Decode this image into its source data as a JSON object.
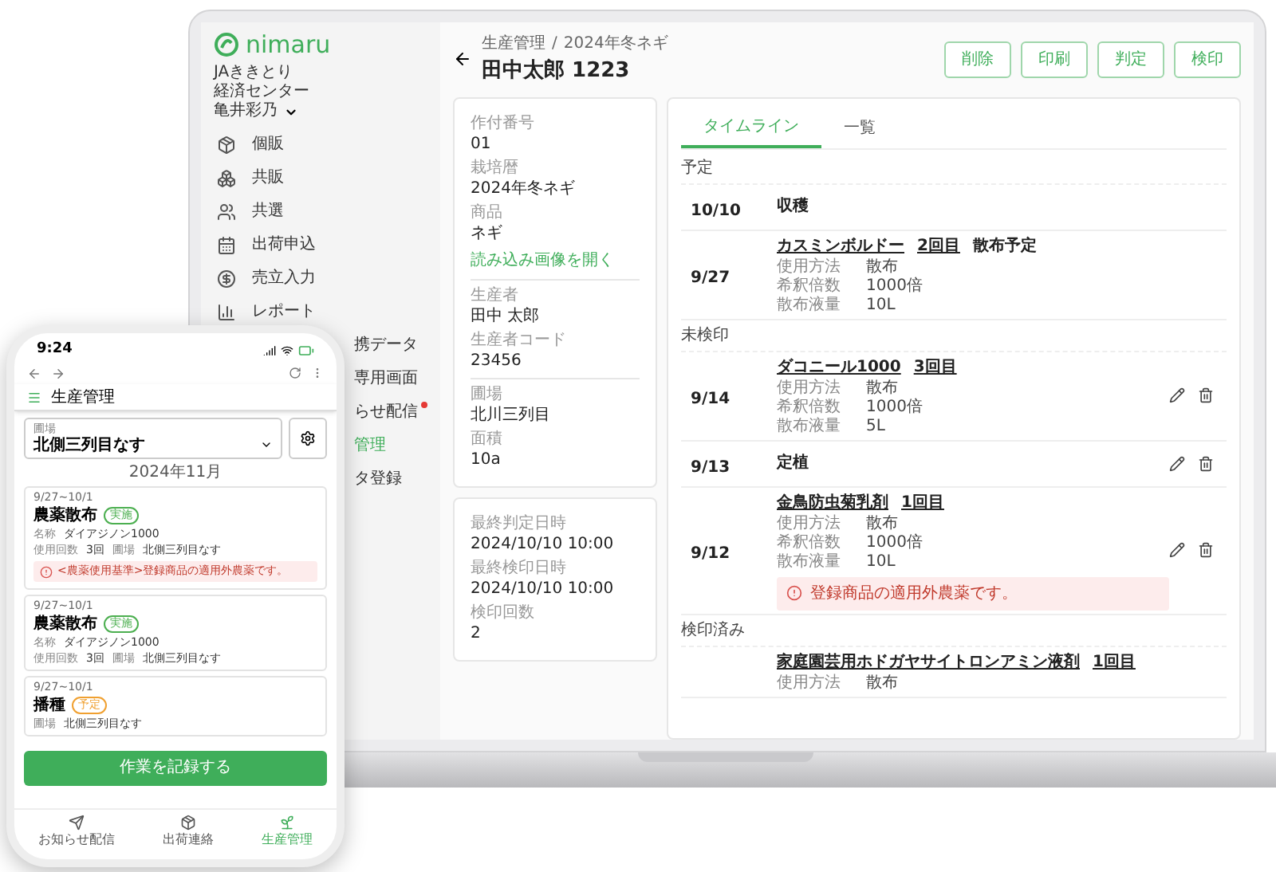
{
  "laptop": {
    "sidebar": {
      "brand": "nimaru",
      "org": [
        "JAききとり",
        "経済センター"
      ],
      "user": "亀井彩乃",
      "items": [
        {
          "label": "個販",
          "kind": "full",
          "selected": false,
          "alert": false
        },
        {
          "label": "共販",
          "kind": "full",
          "selected": false,
          "alert": false
        },
        {
          "label": "共選",
          "kind": "full",
          "selected": false,
          "alert": false
        },
        {
          "label": "出荷申込",
          "kind": "full",
          "selected": false,
          "alert": false
        },
        {
          "label": "売立入力",
          "kind": "full",
          "selected": false,
          "alert": false
        },
        {
          "label": "レポート",
          "kind": "full",
          "selected": false,
          "alert": false
        },
        {
          "label": "携データ",
          "kind": "cut",
          "selected": false,
          "alert": false
        },
        {
          "label": "専用画面",
          "kind": "cut",
          "selected": false,
          "alert": false
        },
        {
          "label": "らせ配信",
          "kind": "cut",
          "selected": false,
          "alert": true
        },
        {
          "label": "管理",
          "kind": "cut",
          "selected": true,
          "alert": false
        },
        {
          "label": "タ登録",
          "kind": "cut",
          "selected": false,
          "alert": false
        }
      ]
    },
    "breadcrumb": {
      "items": [
        "生産管理",
        "2024年冬ネギ"
      ],
      "separator": "/"
    },
    "title": "田中太郎 1223",
    "actions": [
      "削除",
      "印刷",
      "判定",
      "検印"
    ],
    "detail_cards": [
      [
        [
          {
            "label": "作付番号",
            "value": "01"
          },
          {
            "label": "栽培暦",
            "value": "2024年冬ネギ"
          },
          {
            "label": "商品",
            "value": "ネギ"
          },
          {
            "kind": "link",
            "value": "読み込み画像を開く"
          }
        ],
        [
          {
            "label": "生産者",
            "value": "田中 太郎"
          },
          {
            "label": "生産者コード",
            "value": "23456"
          }
        ],
        [
          {
            "label": "圃場",
            "value": "北川三列目"
          },
          {
            "label": "面積",
            "value": "10a"
          }
        ]
      ],
      [
        [
          {
            "label": "最終判定日時",
            "value": "2024/10/10 10:00"
          },
          {
            "label": "最終検印日時",
            "value": "2024/10/10 10:00"
          },
          {
            "label": "検印回数",
            "value": "2"
          }
        ]
      ]
    ],
    "tabs": [
      {
        "label": "タイムライン",
        "selected": true
      },
      {
        "label": "一覧",
        "selected": false
      }
    ],
    "timeline": [
      {
        "heading": "予定",
        "entries": [
          {
            "date": "10/10",
            "title": "収穫",
            "editable": false
          },
          {
            "date": "9/27",
            "product": "カスミンボルドー",
            "count": "2回目",
            "note": "散布予定",
            "details": [
              [
                "使用方法",
                "散布"
              ],
              [
                "希釈倍数",
                "1000倍"
              ],
              [
                "散布液量",
                "10L"
              ]
            ],
            "editable": false
          }
        ]
      },
      {
        "heading": "未検印",
        "entries": [
          {
            "date": "9/14",
            "product": "ダコニール1000",
            "count": "3回目",
            "details": [
              [
                "使用方法",
                "散布"
              ],
              [
                "希釈倍数",
                "1000倍"
              ],
              [
                "散布液量",
                "5L"
              ]
            ],
            "editable": true
          },
          {
            "date": "9/13",
            "title": "定植",
            "editable": true
          },
          {
            "date": "9/12",
            "product": "金鳥防虫菊乳剤",
            "count": "1回目",
            "details": [
              [
                "使用方法",
                "散布"
              ],
              [
                "希釈倍数",
                "1000倍"
              ],
              [
                "散布液量",
                "10L"
              ]
            ],
            "alert": "登録商品の適用外農薬です。",
            "editable": true
          }
        ]
      },
      {
        "heading": "検印済み",
        "entries": [
          {
            "product": "家庭園芸用ホドガヤサイトロンアミン液剤",
            "count": "1回目",
            "details": [
              [
                "使用方法",
                "散布"
              ]
            ],
            "editable": false
          }
        ]
      }
    ]
  },
  "phone": {
    "time": "9:24",
    "header": "生産管理",
    "field": {
      "label": "圃場",
      "value": "北側三列目なす"
    },
    "month": "2024年11月",
    "cards": [
      {
        "date": "9/27~10/1",
        "title": "農薬散布",
        "badge": "実施",
        "color": "#4caf50",
        "info": [
          [
            [
              "名称",
              "ダイアジノン1000"
            ]
          ],
          [
            [
              "使用回数",
              "3回"
            ],
            [
              "圃場",
              "北側三列目なす"
            ]
          ]
        ],
        "alert": "<農薬使用基準>登録商品の適用外農薬です。"
      },
      {
        "date": "9/27~10/1",
        "title": "農薬散布",
        "badge": "実施",
        "color": "#4caf50",
        "info": [
          [
            [
              "名称",
              "ダイアジノン1000"
            ]
          ],
          [
            [
              "使用回数",
              "3回"
            ],
            [
              "圃場",
              "北側三列目なす"
            ]
          ]
        ]
      },
      {
        "date": "9/27~10/1",
        "title": "播種",
        "badge": "予定",
        "color": "#f0a030",
        "info": [
          [
            [
              "圃場",
              "北側三列目なす"
            ]
          ]
        ]
      }
    ],
    "button": "作業を記録する",
    "nav": [
      {
        "label": "お知らせ配信",
        "selected": false
      },
      {
        "label": "出荷連絡",
        "selected": false
      },
      {
        "label": "生産管理",
        "selected": true
      }
    ]
  }
}
